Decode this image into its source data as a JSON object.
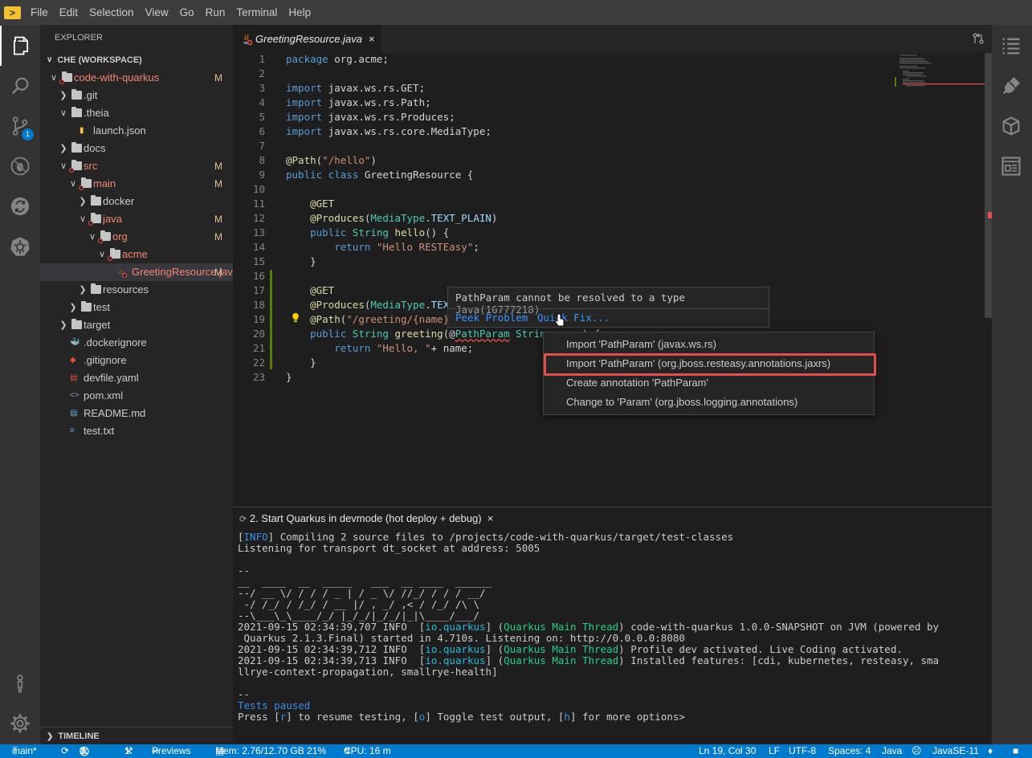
{
  "menu": [
    "File",
    "Edit",
    "Selection",
    "View",
    "Go",
    "Run",
    "Terminal",
    "Help"
  ],
  "explorer": {
    "title": "EXPLORER",
    "workspace": "CHE (WORKSPACE)",
    "timeline": "TIMELINE",
    "tree": [
      {
        "label": "code-with-quarkus",
        "status": "M",
        "indent": 0,
        "kind": "folder",
        "open": true,
        "modified": true
      },
      {
        "label": ".git",
        "status": "",
        "indent": 1,
        "kind": "folder",
        "open": false
      },
      {
        "label": ".theia",
        "status": "",
        "indent": 1,
        "kind": "folder",
        "open": true
      },
      {
        "label": "launch.json",
        "status": "",
        "indent": 2,
        "kind": "json"
      },
      {
        "label": "docs",
        "status": "",
        "indent": 1,
        "kind": "folder",
        "open": false
      },
      {
        "label": "src",
        "status": "M",
        "indent": 1,
        "kind": "folder",
        "open": true,
        "modified": true
      },
      {
        "label": "main",
        "status": "M",
        "indent": 2,
        "kind": "folder",
        "open": true,
        "modified": true
      },
      {
        "label": "docker",
        "status": "",
        "indent": 3,
        "kind": "folder",
        "open": false
      },
      {
        "label": "java",
        "status": "M",
        "indent": 3,
        "kind": "folder",
        "open": true,
        "modified": true
      },
      {
        "label": "org",
        "status": "M",
        "indent": 4,
        "kind": "folder",
        "open": true,
        "modified": true
      },
      {
        "label": "acme",
        "status": "",
        "indent": 5,
        "kind": "folder",
        "open": true,
        "modified": true
      },
      {
        "label": "GreetingResource.java",
        "status": "M",
        "indent": 6,
        "kind": "java",
        "modified": true,
        "selected": true
      },
      {
        "label": "resources",
        "status": "",
        "indent": 3,
        "kind": "folder",
        "open": false
      },
      {
        "label": "test",
        "status": "",
        "indent": 2,
        "kind": "folder",
        "open": false
      },
      {
        "label": "target",
        "status": "",
        "indent": 1,
        "kind": "folder",
        "open": false
      },
      {
        "label": ".dockerignore",
        "status": "",
        "indent": 1,
        "kind": "docker"
      },
      {
        "label": ".gitignore",
        "status": "",
        "indent": 1,
        "kind": "git"
      },
      {
        "label": "devfile.yaml",
        "status": "",
        "indent": 1,
        "kind": "yaml"
      },
      {
        "label": "pom.xml",
        "status": "",
        "indent": 1,
        "kind": "xml"
      },
      {
        "label": "README.md",
        "status": "",
        "indent": 1,
        "kind": "md"
      },
      {
        "label": "test.txt",
        "status": "",
        "indent": 1,
        "kind": "txt"
      }
    ]
  },
  "editor": {
    "tab": "GreetingResource.java",
    "tab_close": "×",
    "lines": [
      [
        [
          "kw",
          "package"
        ],
        [
          "",
          "org.acme;"
        ]
      ],
      [],
      [
        [
          "kw",
          "import"
        ],
        [
          "",
          "javax.ws.rs.GET;"
        ]
      ],
      [
        [
          "kw",
          "import"
        ],
        [
          "",
          "javax.ws.rs.Path;"
        ]
      ],
      [
        [
          "kw",
          "import"
        ],
        [
          "",
          "javax.ws.rs.Produces;"
        ]
      ],
      [
        [
          "kw",
          "import"
        ],
        [
          "",
          "javax.ws.rs.core.MediaType;"
        ]
      ],
      [],
      [
        [
          "an",
          "@Path"
        ],
        [
          "",
          "("
        ],
        [
          "str",
          "\"/hello\""
        ],
        [
          "",
          ")"
        ]
      ],
      [
        [
          "kw",
          "public class"
        ],
        [
          "",
          "GreetingResource {"
        ]
      ],
      [],
      [
        [
          "",
          "    "
        ],
        [
          "an",
          "@GET"
        ]
      ],
      [
        [
          "",
          "    "
        ],
        [
          "an",
          "@Produces"
        ],
        [
          "",
          "("
        ],
        [
          "ty",
          "MediaType"
        ],
        [
          "",
          "."
        ],
        [
          "nm",
          "TEXT_PLAIN"
        ],
        [
          "",
          ")"
        ]
      ],
      [
        [
          "",
          "    "
        ],
        [
          "kw",
          "public"
        ],
        [
          "ty",
          "String"
        ],
        [
          "fn",
          "hello"
        ],
        [
          "",
          "() {"
        ]
      ],
      [
        [
          "",
          "        "
        ],
        [
          "kw",
          "return"
        ],
        [
          "str",
          "\"Hello RESTEasy\""
        ],
        [
          "",
          ";"
        ]
      ],
      [
        [
          "",
          "    }"
        ]
      ],
      [],
      [
        [
          "",
          "    "
        ],
        [
          "an",
          "@GET"
        ]
      ],
      [
        [
          "",
          "    "
        ],
        [
          "an",
          "@Produces"
        ],
        [
          "",
          "("
        ],
        [
          "ty",
          "MediaType"
        ],
        [
          "",
          "."
        ],
        [
          "nm",
          "TEXT"
        ]
      ],
      [
        [
          "",
          "    "
        ],
        [
          "an",
          "@Path"
        ],
        [
          "",
          "("
        ],
        [
          "str",
          "\"/greeting/{name}\""
        ]
      ],
      [
        [
          "",
          "    "
        ],
        [
          "kw",
          "public"
        ],
        [
          "ty",
          "String"
        ],
        [
          "fn",
          "greeting"
        ],
        [
          "",
          "(@"
        ],
        [
          "ty",
          "PathParam"
        ],
        [
          "ty",
          "String"
        ],
        [
          "nm",
          "name"
        ],
        [
          "",
          ") {"
        ]
      ],
      [
        [
          "",
          "        "
        ],
        [
          "kw",
          "return"
        ],
        [
          "str",
          "\"Hello, \""
        ],
        [
          "",
          ""
        ],
        [
          "",
          "+ name;"
        ]
      ],
      [
        [
          "",
          "    }"
        ]
      ],
      [
        [
          "",
          "}"
        ]
      ]
    ]
  },
  "hover": {
    "message": "PathParam cannot be resolved to a type",
    "source": "Java(16777218)",
    "peek": "Peek Problem",
    "quickfix": "Quick Fix..."
  },
  "quickfix_items": [
    "Import 'PathParam' (javax.ws.rs)",
    "Import 'PathParam' (org.jboss.resteasy.annotations.jaxrs)",
    "Create annotation 'PathParam'",
    "Change to 'Param' (org.jboss.logging.annotations)"
  ],
  "panel": {
    "tab": "2. Start Quarkus in devmode (hot deploy + debug)",
    "close": "×"
  },
  "terminal": {
    "info_line": "Compiling 2 source files to /projects/code-with-quarkus/target/test-classes",
    "listen": "Listening for transport dt_socket at address: 5005",
    "sep": "--",
    "banner": [
      "__  ____  __  _____   ___  __ ____  ______",
      "--/ __ \\/ / / / _ | / _ \\/ //_/ / / / __/",
      " -/ /_/ / /_/ / __ |/ , _/ ,< / /_/ /\\ \\",
      "--\\___\\_\\____/_/ |_/_/|_/_/|_|\\____/___/"
    ],
    "logs": [
      {
        "ts": "2021-09-15 02:34:39,707",
        "lvl": "INFO",
        "cat": "io.quarkus",
        "thread": "Quarkus Main Thread",
        "msg": "code-with-quarkus 1.0.0-SNAPSHOT on JVM (powered by"
      },
      {
        "cont": " Quarkus 2.1.3.Final) started in 4.710s. Listening on: http://0.0.0.0:8080"
      },
      {
        "ts": "2021-09-15 02:34:39,712",
        "lvl": "INFO",
        "cat": "io.quarkus",
        "thread": "Quarkus Main Thread",
        "msg": "Profile dev activated. Live Coding activated."
      },
      {
        "ts": "2021-09-15 02:34:39,713",
        "lvl": "INFO",
        "cat": "io.quarkus",
        "thread": "Quarkus Main Thread",
        "msg": "Installed features: [cdi, kubernetes, resteasy, sma"
      },
      {
        "cont": "llrye-context-propagation, smallrye-health]"
      }
    ],
    "paused": "Tests paused",
    "prompt_pre": "Press [",
    "r": "r",
    "p1": "] to resume testing, [",
    "o": "o",
    "p2": "] Toggle test output, [",
    "h": "h",
    "p3": "] for more options>"
  },
  "status": {
    "branch": "main*",
    "errors": "1",
    "warnings": "0",
    "tools": "1",
    "previews": "Previews",
    "mem": "Mem: 2.76/12.70 GB 21%",
    "cpu": "CPU: 16 m",
    "pos": "Ln 19, Col 30",
    "eol": "LF",
    "enc": "UTF-8",
    "spaces": "Spaces: 4",
    "lang": "Java",
    "jdk": "JavaSE-11"
  },
  "source_control_badge": "1"
}
